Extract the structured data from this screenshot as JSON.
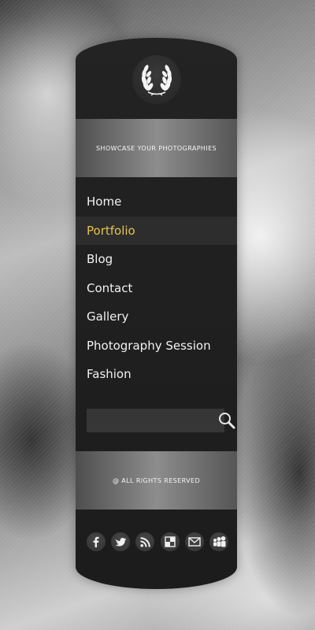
{
  "header": {
    "logo_icon": "laurel-wreath-icon",
    "tagline": "SHOWCASE YOUR PHOTOGRAPHIES"
  },
  "nav": {
    "items": [
      {
        "label": "Home",
        "active": false
      },
      {
        "label": "Portfolio",
        "active": true
      },
      {
        "label": "Blog",
        "active": false
      },
      {
        "label": "Contact",
        "active": false
      },
      {
        "label": "Gallery",
        "active": false
      },
      {
        "label": "Photography Session",
        "active": false
      },
      {
        "label": "Fashion",
        "active": false
      }
    ]
  },
  "search": {
    "value": "",
    "placeholder": "",
    "icon": "search-icon"
  },
  "footer": {
    "copyright": "@ ALL RIGHTS RESERVED",
    "social": [
      {
        "icon": "facebook-icon"
      },
      {
        "icon": "twitter-icon"
      },
      {
        "icon": "rss-icon"
      },
      {
        "icon": "delicious-icon"
      },
      {
        "icon": "email-icon"
      },
      {
        "icon": "myspace-icon"
      }
    ]
  },
  "colors": {
    "active_nav": "#e6c34a",
    "panel": "#1f1f1f",
    "text": "#f2f2f2"
  }
}
